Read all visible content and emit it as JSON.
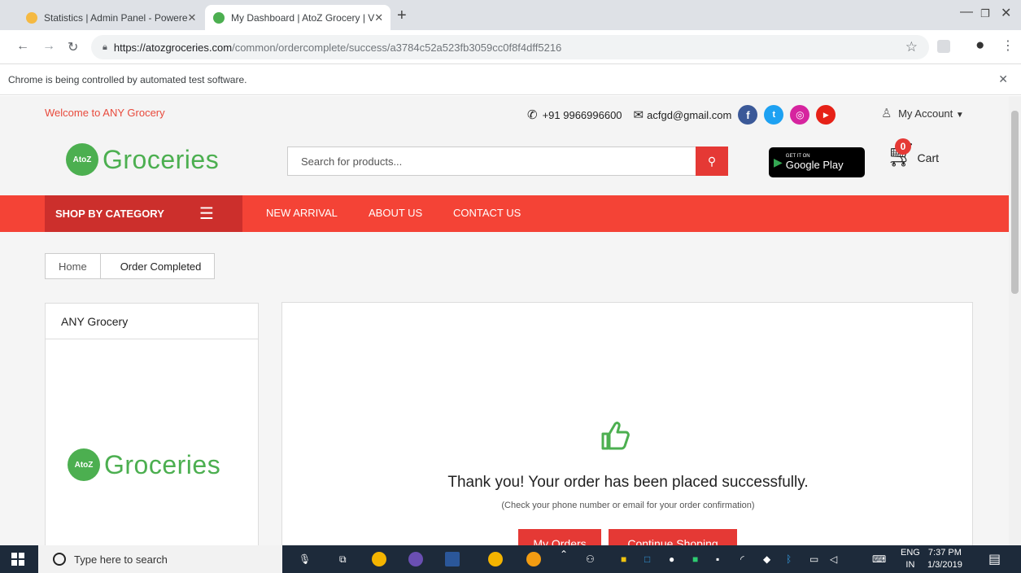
{
  "browser": {
    "tabs": [
      {
        "label": "Statistics | Admin Panel - Powere",
        "active": false
      },
      {
        "label": "My Dashboard | AtoZ Grocery | V",
        "active": true
      }
    ],
    "url_host": "https://atozgroceries.com",
    "url_path": "/common/ordercomplete/success/a3784c52a523fb3059cc0f8f4dff5216",
    "infobar_text": "Chrome is being controlled by automated test software."
  },
  "topbar": {
    "welcome": "Welcome to ANY Grocery",
    "phone": "+91 9966996600",
    "email": "acfgd@gmail.com",
    "account": "My Account"
  },
  "header": {
    "logo_badge": "AtoZ",
    "logo_word": "Groceries",
    "search_placeholder": "Search for products...",
    "gplay_small": "GET IT ON",
    "gplay_big": "Google Play",
    "cart_count": "0",
    "cart_label": "Cart"
  },
  "nav": {
    "category": "SHOP BY CATEGORY",
    "links": [
      "NEW ARRIVAL",
      "ABOUT US",
      "CONTACT US"
    ]
  },
  "breadcrumb": [
    "Home",
    "Order Completed"
  ],
  "sidebar": {
    "title": "ANY Grocery"
  },
  "main": {
    "title": "Thank you! Your order has been placed successfully.",
    "subtitle": "(Check your phone number or email for your order confirmation)",
    "btn_orders": "My Orders",
    "btn_continue": "Continue Shoping"
  },
  "taskbar": {
    "search_placeholder": "Type here to search",
    "lang_1": "ENG",
    "lang_2": "IN",
    "time": "7:37 PM",
    "date": "1/3/2019"
  },
  "colors": {
    "brand_red": "#f44336",
    "brand_green": "#4caf50"
  }
}
